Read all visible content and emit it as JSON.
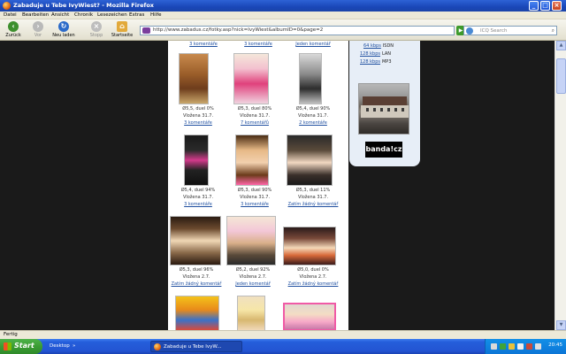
{
  "window": {
    "title": "Zabaduje u Tebe IvyWiest? - Mozilla Firefox"
  },
  "menu": [
    "Datei",
    "Bearbeiten",
    "Ansicht",
    "Chronik",
    "Lesezeichen",
    "Extras",
    "Hilfe"
  ],
  "nav": {
    "back": "Zurück",
    "forward": "Vor",
    "reload": "Neu laden",
    "stop": "Stopp",
    "home": "Startseite",
    "url": "http://www.zabadus.cz/fotky.asp?nick=IvyWiest&albumID=0&page=2",
    "search_placeholder": "ICQ Search"
  },
  "gallery": {
    "top_links": [
      "3 komentáře",
      "3 komentáře",
      "Jeden komentář"
    ],
    "rows": [
      {
        "cells": [
          {
            "rating": "Ø5,5, duel 0%",
            "date": "Vložena 31.7.",
            "comments": "3 komentáře"
          },
          {
            "rating": "Ø5,3, duel 80%",
            "date": "Vložena 31.7.",
            "comments": "7 komentářů"
          },
          {
            "rating": "Ø5,4, duel 90%",
            "date": "Vložena 31.7.",
            "comments": "2 komentáře"
          }
        ]
      },
      {
        "cells": [
          {
            "rating": "Ø5,4, duel 94%",
            "date": "Vložena 31.7.",
            "comments": "3 komentáře"
          },
          {
            "rating": "Ø5,3, duel 90%",
            "date": "Vložena 31.7.",
            "comments": "3 komentáře"
          },
          {
            "rating": "Ø5,3, duel 11%",
            "date": "Vložena 31.7.",
            "comments": "Zatím žádný komentář"
          }
        ]
      },
      {
        "cells": [
          {
            "rating": "Ø5,3, duel 96%",
            "date": "Vložena 2.7.",
            "comments": "Zatím žádný komentář"
          },
          {
            "rating": "Ø5,2, duel 92%",
            "date": "Vložena 2.7.",
            "comments": "Jeden komentář"
          },
          {
            "rating": "Ø5,0, duel 0%",
            "date": "Vložena 2.7.",
            "comments": "Zatím žádný komentář"
          }
        ]
      }
    ]
  },
  "sidebar": {
    "speeds": [
      {
        "speed": "64 kbps",
        "type": "ISDN"
      },
      {
        "speed": "128 kbps",
        "type": "LAN"
      },
      {
        "speed": "128 kbps",
        "type": "MP3"
      }
    ],
    "logo": "banda!cz"
  },
  "status": "Fertig",
  "taskbar": {
    "start": "Start",
    "desktop": "Desktop",
    "task": "Zabaduje u Tebe IvyW...",
    "clock": "20:45"
  }
}
